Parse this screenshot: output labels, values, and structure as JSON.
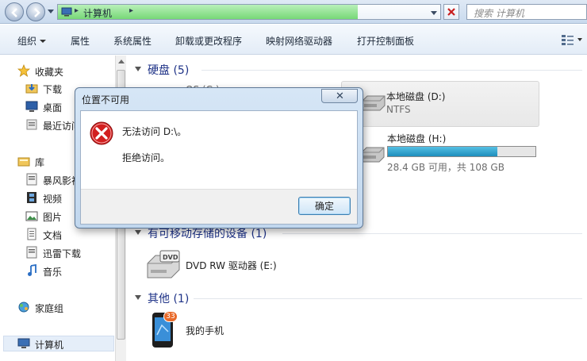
{
  "address": {
    "path": "计算机",
    "search_placeholder": "搜索 计算机"
  },
  "toolbar": {
    "organize": "组织",
    "properties": "属性",
    "system_properties": "系统属性",
    "uninstall": "卸载或更改程序",
    "map_drive": "映射网络驱动器",
    "control_panel": "打开控制面板"
  },
  "sidebar": {
    "favorites": "收藏夹",
    "downloads": "下载",
    "desktop": "桌面",
    "recent": "最近访问",
    "libraries": "库",
    "storm": "暴风影视",
    "videos": "视频",
    "pictures": "图片",
    "documents": "文档",
    "thunder": "迅雷下载",
    "music": "音乐",
    "homegroup": "家庭组",
    "computer": "计算机"
  },
  "main": {
    "hdd_group": "硬盘 (5)",
    "drive_c_partial": "OS (C:)",
    "drive_d": {
      "name": "本地磁盘 (D:)",
      "fs": "NTFS"
    },
    "drive_h": {
      "name": "本地磁盘 (H:)",
      "free": "28.4 GB 可用，共 108 GB",
      "used_fraction": 0.74
    },
    "removable_group": "有可移动存储的设备 (1)",
    "dvd": "DVD RW 驱动器 (E:)",
    "other_group": "其他 (1)",
    "phone": "我的手机",
    "phone_badge": "33"
  },
  "dialog": {
    "title": "位置不可用",
    "close_glyph": "✕",
    "message": "无法访问 D:\\。",
    "detail": "拒绝访问。",
    "ok": "确定"
  },
  "colors": {
    "address_fill": "#77d877",
    "group_header": "#1e3287",
    "capacity_fill": "#1e8ebc",
    "error_red": "#d21f1f"
  }
}
